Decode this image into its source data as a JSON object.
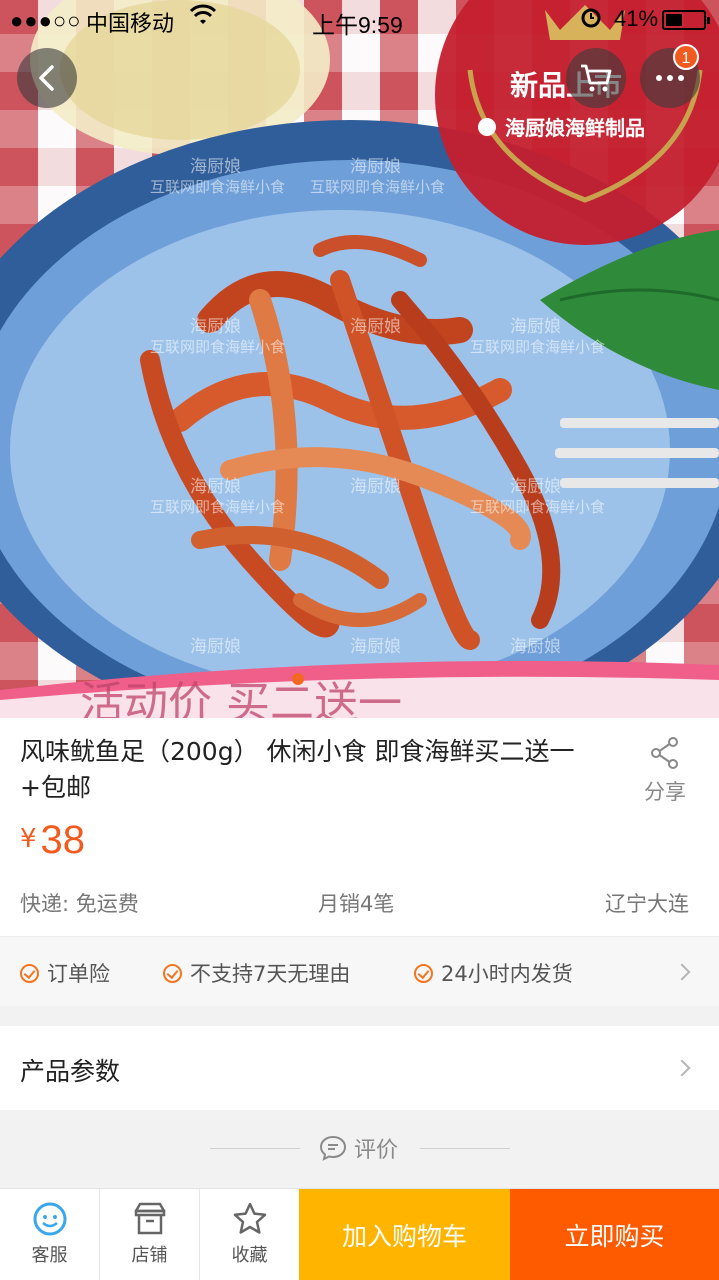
{
  "status_bar": {
    "signal": "●●●○○",
    "carrier": "中国移动",
    "time": "上午9:59",
    "battery": "41%"
  },
  "gallery": {
    "overlay_badge_title": "新品上市",
    "overlay_badge_subtitle": "海厨娘海鲜制品",
    "watermark_brand": "海厨娘",
    "watermark_slogan": "互联网即食海鲜小食",
    "banner_text": "活动价 买二送一",
    "cart_count": "1"
  },
  "product": {
    "title": "风味鱿鱼足（200g） 休闲小食 即食海鲜买二送一+包邮",
    "share_label": "分享",
    "currency": "¥",
    "price": "38",
    "shipping": "快递: 免运费",
    "monthly_sales": "月销4笔",
    "location": "辽宁大连"
  },
  "services": [
    "订单险",
    "不支持7天无理由",
    "24小时内发货"
  ],
  "params_label": "产品参数",
  "reviews_label": "评价",
  "bottom_bar": {
    "customer_service": "客服",
    "shop": "店铺",
    "favorite": "收藏",
    "add_to_cart": "加入购物车",
    "buy_now": "立即购买"
  },
  "colors": {
    "accent": "#f25a1e",
    "cart_button": "#ffb400",
    "buy_button": "#fe5a00"
  }
}
